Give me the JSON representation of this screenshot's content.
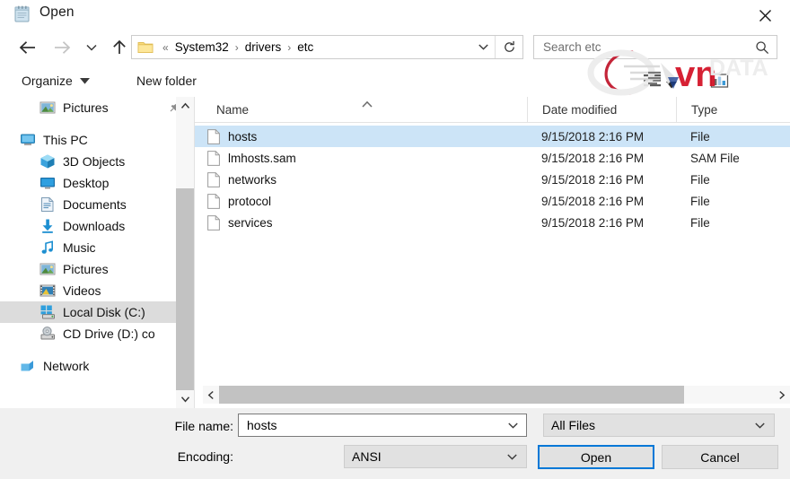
{
  "window": {
    "title": "Open",
    "icon": "notepad-icon",
    "close_label": "✕"
  },
  "nav": {
    "back": "back-arrow-icon",
    "forward": "forward-arrow-icon",
    "recent": "recent-locations-icon",
    "up": "up-arrow-icon",
    "refresh": "refresh-icon"
  },
  "address": {
    "folder_icon": "folder-icon",
    "prefix": "«",
    "crumbs": [
      "System32",
      "drivers",
      "etc"
    ],
    "separator": "›"
  },
  "search": {
    "placeholder": "Search etc",
    "value": "",
    "icon": "search-icon"
  },
  "commandbar": {
    "organize_label": "Organize",
    "new_folder_label": "New folder",
    "view_icon": "view-list-icon",
    "change_view_icon": "change-view-icon",
    "help_icon": "help-icon"
  },
  "watermark": {
    "text": "vn",
    "suffix": "DATA",
    "arc_color": "#c0152b",
    "text_color": "#d31125",
    "ghost_color": "#e8e8e8"
  },
  "navpane": {
    "items": [
      {
        "label": "Pictures",
        "icon": "pictures-icon",
        "indent": 1,
        "selected": false,
        "pinned": true
      },
      {
        "label": "This PC",
        "icon": "thispc-icon",
        "indent": 0,
        "selected": false,
        "pinned": false
      },
      {
        "label": "3D Objects",
        "icon": "3dobjects-icon",
        "indent": 1,
        "selected": false,
        "pinned": false
      },
      {
        "label": "Desktop",
        "icon": "desktop-icon",
        "indent": 1,
        "selected": false,
        "pinned": false
      },
      {
        "label": "Documents",
        "icon": "documents-icon",
        "indent": 1,
        "selected": false,
        "pinned": false
      },
      {
        "label": "Downloads",
        "icon": "downloads-icon",
        "indent": 1,
        "selected": false,
        "pinned": false
      },
      {
        "label": "Music",
        "icon": "music-icon",
        "indent": 1,
        "selected": false,
        "pinned": false
      },
      {
        "label": "Pictures",
        "icon": "pictures-icon",
        "indent": 1,
        "selected": false,
        "pinned": false
      },
      {
        "label": "Videos",
        "icon": "videos-icon",
        "indent": 1,
        "selected": false,
        "pinned": false
      },
      {
        "label": "Local Disk (C:)",
        "icon": "harddrive-icon",
        "indent": 1,
        "selected": true,
        "pinned": false
      },
      {
        "label": "CD Drive (D:) co",
        "icon": "cddrive-icon",
        "indent": 1,
        "selected": false,
        "pinned": false
      },
      {
        "label": "Network",
        "icon": "network-icon",
        "indent": 0,
        "selected": false,
        "pinned": false
      }
    ]
  },
  "filelist": {
    "columns": [
      "Name",
      "Date modified",
      "Type"
    ],
    "sort_column": "Name",
    "sort_direction": "ascending",
    "rows": [
      {
        "name": "hosts",
        "date": "9/15/2018 2:16 PM",
        "type": "File",
        "selected": true
      },
      {
        "name": "lmhosts.sam",
        "date": "9/15/2018 2:16 PM",
        "type": "SAM File",
        "selected": false
      },
      {
        "name": "networks",
        "date": "9/15/2018 2:16 PM",
        "type": "File",
        "selected": false
      },
      {
        "name": "protocol",
        "date": "9/15/2018 2:16 PM",
        "type": "File",
        "selected": false
      },
      {
        "name": "services",
        "date": "9/15/2018 2:16 PM",
        "type": "File",
        "selected": false
      }
    ]
  },
  "bottom": {
    "filename_label": "File name:",
    "filename_value": "hosts",
    "encoding_label": "Encoding:",
    "encoding_value": "ANSI",
    "filter_value": "All Files",
    "open_label": "Open",
    "cancel_label": "Cancel"
  },
  "colors": {
    "selection_blue": "#cce4f7",
    "focus_border": "#0078d7",
    "tree_selected": "#dcdcdc",
    "panel_bg": "#f0f0f0",
    "scrollbar_thumb": "#c2c2c2"
  }
}
